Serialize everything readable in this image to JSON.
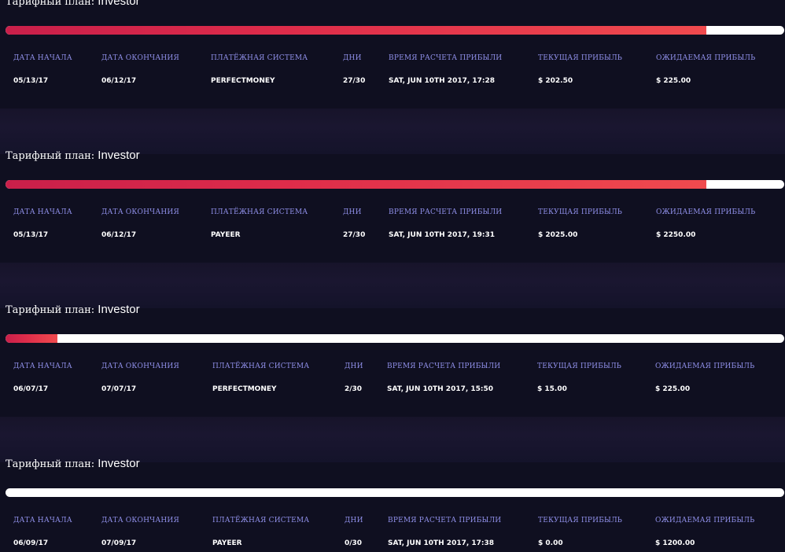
{
  "headers": {
    "start_date": "ДАТА НАЧАЛА",
    "end_date": "ДАТА ОКОНЧАНИЯ",
    "payment_system": "ПЛАТЁЖНАЯ СИСТЕМА",
    "days": "ДНИ",
    "profit_time": "ВРЕМЯ РАСЧЕТА ПРИБЫЛИ",
    "current_profit": "ТЕКУЩАЯ ПРИБЫЛЬ",
    "expected_profit": "ОЖИДАЕМАЯ ПРИБЫЛЬ"
  },
  "colors": {
    "background": "#0f0f20",
    "header_text": "#8f8fe8",
    "progress_start": "#c91f4a",
    "progress_end": "#f04a4e",
    "track": "#ffffff"
  },
  "deposits": [
    {
      "plan_prefix": "Тарифный план:",
      "plan_name": "Investor",
      "progress": 0.9,
      "start_date": "05/13/17",
      "end_date": "06/12/17",
      "payment_system": "PERFECTMONEY",
      "days": "27/30",
      "profit_time": "SAT, JUN 10TH 2017, 17:28",
      "current_profit": "$ 202.50",
      "expected_profit": "$ 225.00"
    },
    {
      "plan_prefix": "Тарифный план:",
      "plan_name": "Investor",
      "progress": 0.9,
      "start_date": "05/13/17",
      "end_date": "06/12/17",
      "payment_system": "PAYEER",
      "days": "27/30",
      "profit_time": "SAT, JUN 10TH 2017, 19:31",
      "current_profit": "$ 2025.00",
      "expected_profit": "$ 2250.00"
    },
    {
      "plan_prefix": "Тарифный план:",
      "plan_name": "Investor",
      "progress": 0.0667,
      "start_date": "06/07/17",
      "end_date": "07/07/17",
      "payment_system": "PERFECTMONEY",
      "days": "2/30",
      "profit_time": "SAT, JUN 10TH 2017, 15:50",
      "current_profit": "$ 15.00",
      "expected_profit": "$ 225.00"
    },
    {
      "plan_prefix": "Тарифный план:",
      "plan_name": "Investor",
      "progress": 0,
      "start_date": "06/09/17",
      "end_date": "07/09/17",
      "payment_system": "PAYEER",
      "days": "0/30",
      "profit_time": "SAT, JUN 10TH 2017, 17:38",
      "current_profit": "$ 0.00",
      "expected_profit": "$ 1200.00"
    }
  ]
}
